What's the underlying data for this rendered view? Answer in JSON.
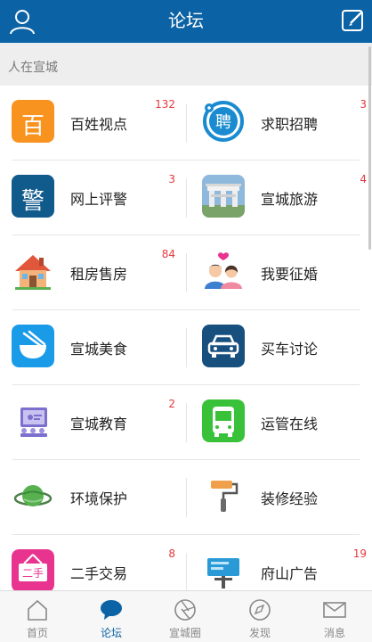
{
  "header": {
    "title": "论坛"
  },
  "section": {
    "label": "人在宣城"
  },
  "forums": [
    {
      "name": "百姓视点",
      "count": "132",
      "icon": "baixing-icon",
      "icon_text": "百",
      "color": "#f7931e"
    },
    {
      "name": "求职招聘",
      "count": "3",
      "icon": "job-icon",
      "icon_text": "聘",
      "color": "#1a8bd0"
    },
    {
      "name": "网上评警",
      "count": "3",
      "icon": "police-icon",
      "icon_text": "警",
      "color": "#115a8c"
    },
    {
      "name": "宣城旅游",
      "count": "4",
      "icon": "travel-icon",
      "color": "#6aa0cf"
    },
    {
      "name": "租房售房",
      "count": "84",
      "icon": "house-icon",
      "color": "#e0573b"
    },
    {
      "name": "我要征婚",
      "count": "",
      "icon": "couple-icon",
      "color": "#f08aa0"
    },
    {
      "name": "宣城美食",
      "count": "",
      "icon": "food-icon",
      "color": "#1a9be8"
    },
    {
      "name": "买车讨论",
      "count": "",
      "icon": "car-icon",
      "color": "#174f7e"
    },
    {
      "name": "宣城教育",
      "count": "2",
      "icon": "education-icon",
      "color": "#7b6fcf"
    },
    {
      "name": "运管在线",
      "count": "",
      "icon": "bus-icon",
      "color": "#3ac13a"
    },
    {
      "name": "环境保护",
      "count": "",
      "icon": "planet-icon",
      "color": "#59b04f"
    },
    {
      "name": "装修经验",
      "count": "",
      "icon": "paint-roller-icon",
      "color": "#f0a04b"
    },
    {
      "name": "二手交易",
      "count": "8",
      "icon": "second-hand-icon",
      "icon_text": "二手",
      "color": "#e8348f"
    },
    {
      "name": "府山广告",
      "count": "19",
      "icon": "billboard-icon",
      "color": "#2a9ad6"
    }
  ],
  "tabbar": [
    {
      "label": "首页",
      "icon": "home-icon"
    },
    {
      "label": "论坛",
      "icon": "chat-bubble-icon"
    },
    {
      "label": "宣城圈",
      "icon": "shutter-icon"
    },
    {
      "label": "发现",
      "icon": "compass-icon"
    },
    {
      "label": "消息",
      "icon": "mail-icon"
    }
  ],
  "active_tab": "论坛",
  "colors": {
    "brand": "#0b62a4",
    "badge": "#e4393c"
  }
}
